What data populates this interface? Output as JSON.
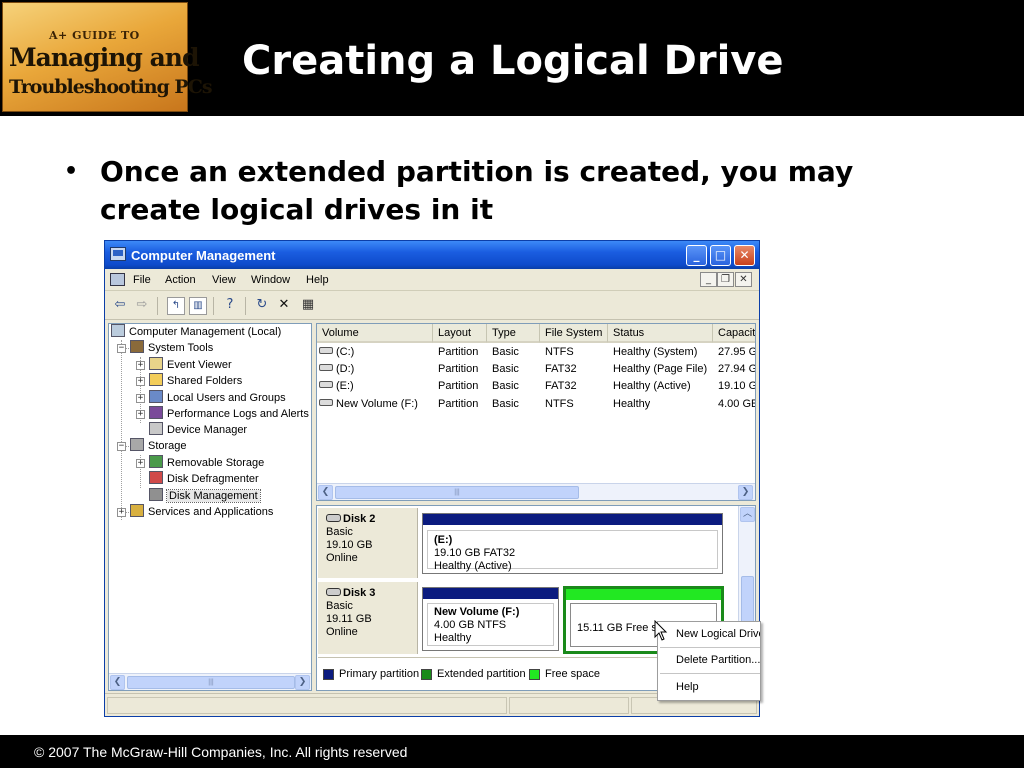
{
  "slide": {
    "title": "Creating a Logical Drive",
    "logo": {
      "line1": "A+ GUIDE TO",
      "line2": "Managing and",
      "line3": "Troubleshooting PCs"
    },
    "bullet": "Once an extended partition is created, you may create logical drives in it",
    "footer": "© 2007 The McGraw-Hill Companies, Inc. All rights reserved"
  },
  "window": {
    "title": "Computer Management",
    "menu": [
      "File",
      "Action",
      "View",
      "Window",
      "Help"
    ],
    "tree": [
      {
        "label": "Computer Management (Local)",
        "icon": "computer-icon"
      },
      {
        "label": "System Tools",
        "icon": "tools-icon"
      },
      {
        "label": "Event Viewer",
        "icon": "event-viewer-icon"
      },
      {
        "label": "Shared Folders",
        "icon": "folder-icon"
      },
      {
        "label": "Local Users and Groups",
        "icon": "users-icon"
      },
      {
        "label": "Performance Logs and Alerts",
        "icon": "performance-icon"
      },
      {
        "label": "Device Manager",
        "icon": "device-manager-icon"
      },
      {
        "label": "Storage",
        "icon": "storage-icon"
      },
      {
        "label": "Removable Storage",
        "icon": "removable-storage-icon"
      },
      {
        "label": "Disk Defragmenter",
        "icon": "defragmenter-icon"
      },
      {
        "label": "Disk Management",
        "icon": "disk-management-icon"
      },
      {
        "label": "Services and Applications",
        "icon": "services-icon"
      }
    ],
    "volumes": {
      "columns": [
        "Volume",
        "Layout",
        "Type",
        "File System",
        "Status",
        "Capacit"
      ],
      "rows": [
        [
          "(C:)",
          "Partition",
          "Basic",
          "NTFS",
          "Healthy (System)",
          "27.95 G"
        ],
        [
          "(D:)",
          "Partition",
          "Basic",
          "FAT32",
          "Healthy (Page File)",
          "27.94 G"
        ],
        [
          "(E:)",
          "Partition",
          "Basic",
          "FAT32",
          "Healthy (Active)",
          "19.10 G"
        ],
        [
          "New Volume (F:)",
          "Partition",
          "Basic",
          "NTFS",
          "Healthy",
          "4.00 GE"
        ]
      ]
    },
    "disks": [
      {
        "name": "Disk 2",
        "type": "Basic",
        "size": "19.10 GB",
        "state": "Online",
        "partitions": [
          {
            "title": "(E:)",
            "line2": "19.10 GB FAT32",
            "line3": "Healthy (Active)"
          }
        ]
      },
      {
        "name": "Disk 3",
        "type": "Basic",
        "size": "19.11 GB",
        "state": "Online",
        "partitions": [
          {
            "title": "New Volume  (F:)",
            "line2": "4.00 GB NTFS",
            "line3": "Healthy"
          },
          {
            "title": "15.11 GB",
            "line2": "Free space"
          }
        ]
      }
    ],
    "legend": [
      {
        "label": "Primary partition",
        "color": "#0b1b7f"
      },
      {
        "label": "Extended partition",
        "color": "#1a8a1a"
      },
      {
        "label": "Free space",
        "color": "#22e822"
      }
    ],
    "context_menu": [
      "New Logical Drive...",
      "Delete Partition...",
      "Help"
    ]
  }
}
